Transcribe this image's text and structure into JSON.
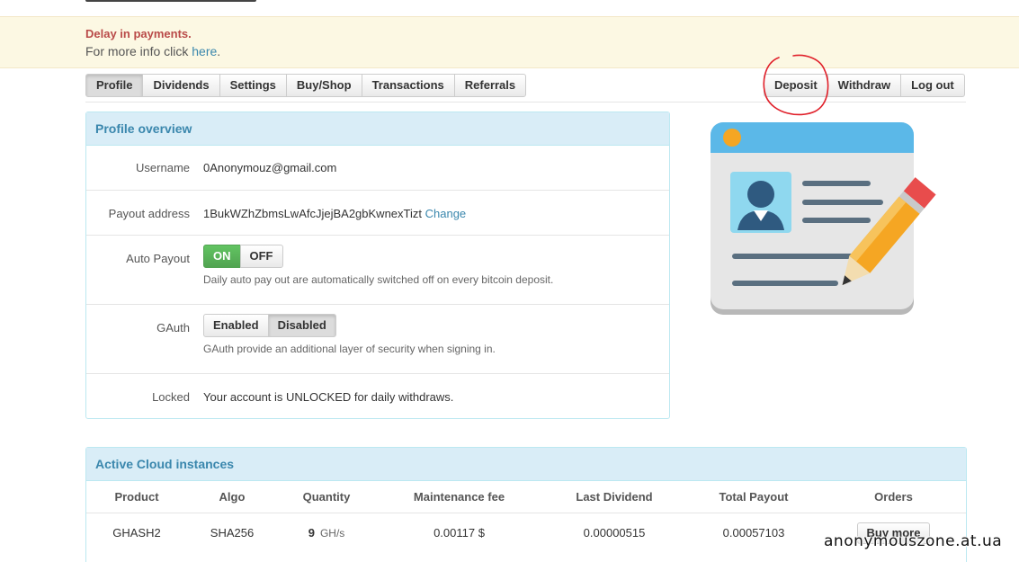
{
  "alert": {
    "title": "Delay in payments.",
    "text_prefix": "For more info click ",
    "link": "here",
    "text_suffix": "."
  },
  "nav": {
    "left": [
      "Profile",
      "Dividends",
      "Settings",
      "Buy/Shop",
      "Transactions",
      "Referrals"
    ],
    "active": "Profile",
    "right": [
      "Deposit",
      "Withdraw",
      "Log out"
    ]
  },
  "profile": {
    "heading": "Profile overview",
    "username_label": "Username",
    "username": "0Anonymouz@gmail.com",
    "payout_label": "Payout address",
    "payout_address": "1BukWZhZbmsLwAfcJjejBA2gbKwnexTizt",
    "payout_change": "Change",
    "autopayout_label": "Auto Payout",
    "autopayout_on": "ON",
    "autopayout_off": "OFF",
    "autopayout_help": "Daily auto pay out are automatically switched off on every bitcoin deposit.",
    "gauth_label": "GAuth",
    "gauth_enabled": "Enabled",
    "gauth_disabled": "Disabled",
    "gauth_help": "GAuth provide an additional layer of security when signing in.",
    "locked_label": "Locked",
    "locked_status": "Your account is UNLOCKED for daily withdraws."
  },
  "cloud": {
    "heading": "Active Cloud instances",
    "columns": [
      "Product",
      "Algo",
      "Quantity",
      "Maintenance fee",
      "Last Dividend",
      "Total Payout",
      "Orders"
    ],
    "rows": [
      {
        "product": "GHASH2",
        "algo": "SHA256",
        "quantity": "9",
        "unit": "GH/s",
        "fee": "0.00117 $",
        "last_dividend": "0.00000515",
        "total_payout": "0.00057103",
        "order_button": "Buy more"
      }
    ]
  },
  "watermark": "anonymouszone.at.ua",
  "icons": [
    "profile-card-pencil-icon",
    "deposit-highlight-circle"
  ],
  "colors": {
    "alert_bg": "#fcf8e3",
    "alert_title": "#b94a48",
    "panel_heading_bg": "#d9edf7",
    "panel_heading_text": "#3a87ad",
    "on_green": "#5bb75b",
    "unlocked_green": "#4cae4c",
    "annotation_red": "#e0202a"
  }
}
